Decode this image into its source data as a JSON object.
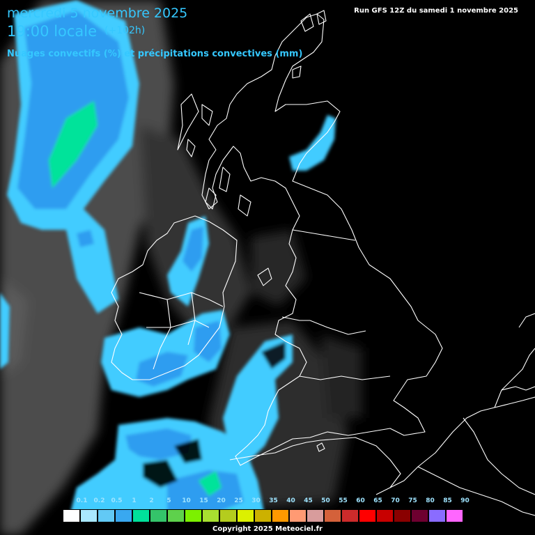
{
  "header": {
    "date": "mercredi 5 novembre 2025",
    "time": "19:00 locale",
    "offset": "(+102h)",
    "subtitle": "Nuages convectifs (%) et précipitations convectives (mm)",
    "run": "Run GFS 12Z du samedi 1 novembre 2025"
  },
  "footer": {
    "copyright": "Copyright 2025 Meteociel.fr"
  },
  "legend": [
    {
      "label": "0.1",
      "color": "#ffffff"
    },
    {
      "label": "0.2",
      "color": "#a9e8ff"
    },
    {
      "label": "0.5",
      "color": "#62c9f5"
    },
    {
      "label": "1",
      "color": "#39a8f0"
    },
    {
      "label": "2",
      "color": "#00e09a"
    },
    {
      "label": "5",
      "color": "#34c46a"
    },
    {
      "label": "10",
      "color": "#5ed14c"
    },
    {
      "label": "15",
      "color": "#7cf000"
    },
    {
      "label": "20",
      "color": "#a8e030"
    },
    {
      "label": "25",
      "color": "#b4cc1e"
    },
    {
      "label": "30",
      "color": "#dcf000"
    },
    {
      "label": "35",
      "color": "#ccb100"
    },
    {
      "label": "40",
      "color": "#ff9900"
    },
    {
      "label": "45",
      "color": "#ff9a73"
    },
    {
      "label": "50",
      "color": "#d89c9c"
    },
    {
      "label": "55",
      "color": "#d4613a"
    },
    {
      "label": "60",
      "color": "#cc2b2b"
    },
    {
      "label": "65",
      "color": "#ff0000"
    },
    {
      "label": "70",
      "color": "#c80000"
    },
    {
      "label": "75",
      "color": "#8a0000"
    },
    {
      "label": "80",
      "color": "#6e0030"
    },
    {
      "label": "85",
      "color": "#8a6cff"
    },
    {
      "label": "90",
      "color": "#ff66ff"
    }
  ]
}
